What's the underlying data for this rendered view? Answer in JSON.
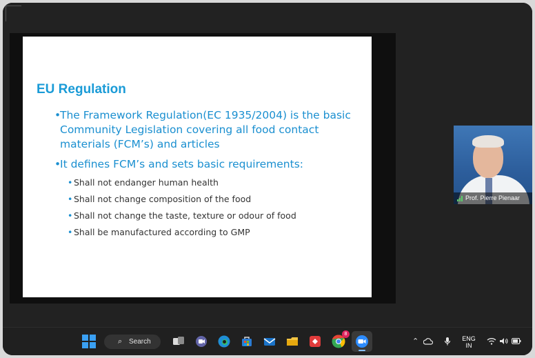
{
  "slide": {
    "title": "EU Regulation",
    "bullets": [
      {
        "text": "The Framework Regulation(EC 1935/2004) is the basic Community Legislation covering all food contact materials (FCM’s) and articles"
      },
      {
        "text": "It defines FCM’s and sets basic requirements:",
        "sub_bullets": [
          "Shall not endanger human health",
          "Shall not change composition of the food",
          "Shall not change the taste, texture or odour of food",
          "Shall be manufactured according to GMP"
        ]
      }
    ]
  },
  "participant": {
    "name": "Prof. Pierre Pienaar"
  },
  "taskbar": {
    "search_label": "Search",
    "chrome_badge": "8",
    "language": "ENG",
    "region": "IN"
  },
  "colors": {
    "slide_heading": "#1a9bd7",
    "slide_bullet": "#1a8fd0",
    "slide_body": "#333333",
    "taskbar": "#202020"
  },
  "icons": [
    "windows-start-icon",
    "search-icon",
    "task-view-icon",
    "teams-meet-icon",
    "edge-icon",
    "store-icon",
    "mail-icon",
    "file-explorer-icon",
    "app-icon",
    "chrome-icon",
    "zoom-icon",
    "chevron-up-icon",
    "onedrive-icon",
    "microphone-icon",
    "wifi-icon",
    "volume-icon",
    "battery-icon"
  ]
}
